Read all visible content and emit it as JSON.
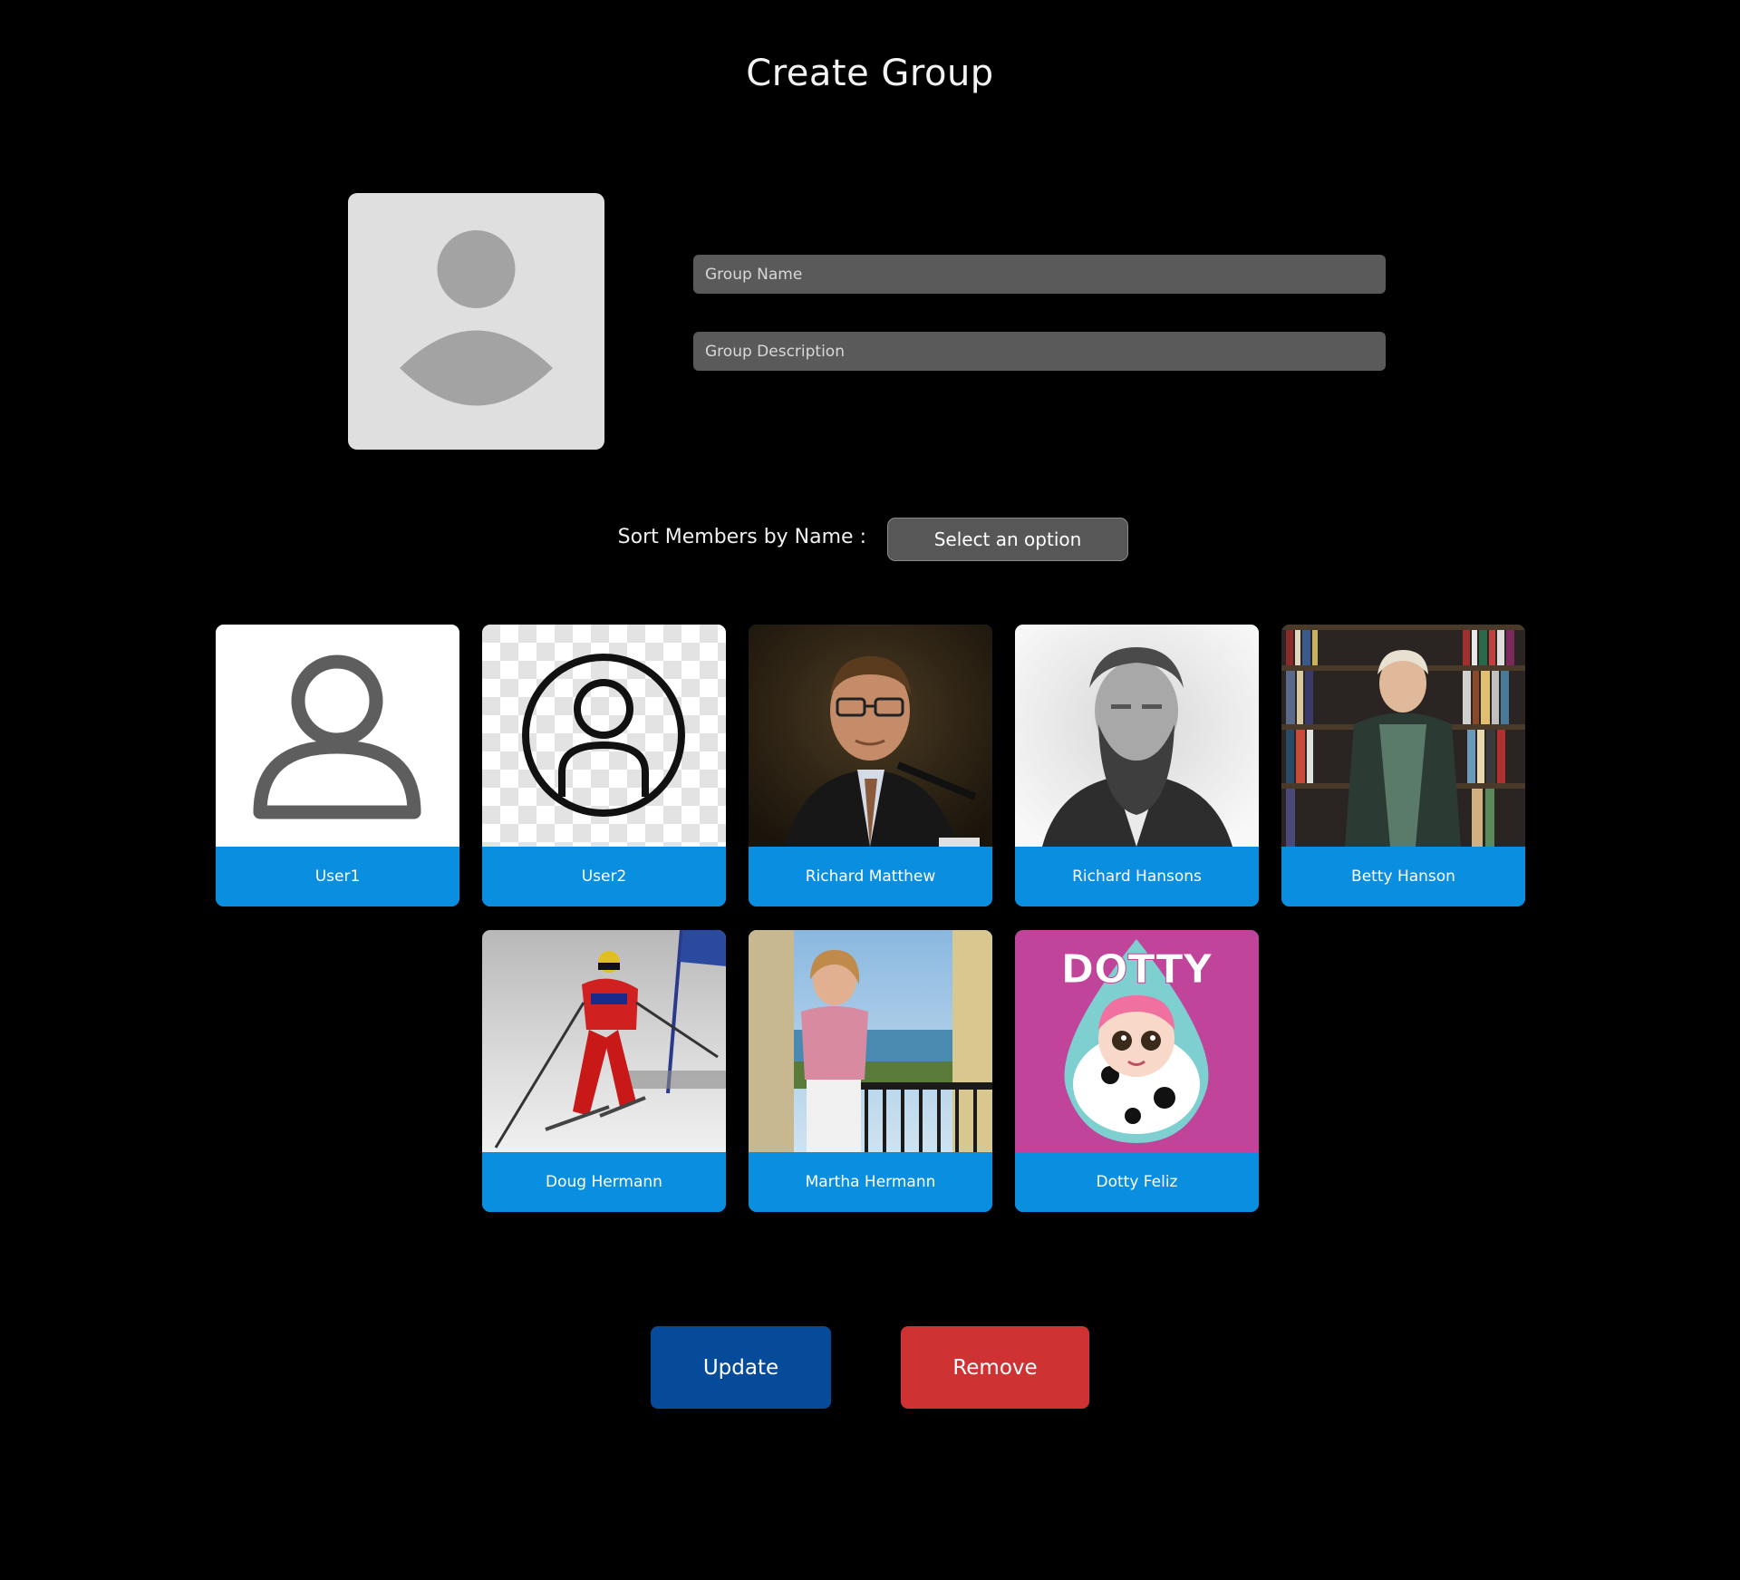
{
  "page": {
    "title": "Create Group"
  },
  "form": {
    "group_name_placeholder": "Group Name",
    "group_description_placeholder": "Group Description",
    "group_avatar_icon": "person-placeholder-icon"
  },
  "sort": {
    "label": "Sort Members by Name :",
    "selected": "Select an option"
  },
  "members": [
    {
      "name": "User1",
      "photo": "outline-person-icon"
    },
    {
      "name": "User2",
      "photo": "circle-person-icon"
    },
    {
      "name": "Richard Matthew",
      "photo": "man-glasses-microphone-photo"
    },
    {
      "name": "Richard Hansons",
      "photo": "bearded-man-portrait-photo"
    },
    {
      "name": "Betty Hanson",
      "photo": "woman-bookshelf-photo"
    },
    {
      "name": "Doug Hermann",
      "photo": "skier-photo"
    },
    {
      "name": "Martha Hermann",
      "photo": "woman-balcony-photo"
    },
    {
      "name": "Dotty Feliz",
      "photo": "dotty-cartoon-photo"
    }
  ],
  "dotty_logo_text": "DOTTY",
  "actions": {
    "update_label": "Update",
    "remove_label": "Remove"
  },
  "colors": {
    "background": "#000000",
    "card_label": "#0a8fe0",
    "update": "#064a9a",
    "remove": "#cf3232",
    "field": "#5a5a5a"
  }
}
